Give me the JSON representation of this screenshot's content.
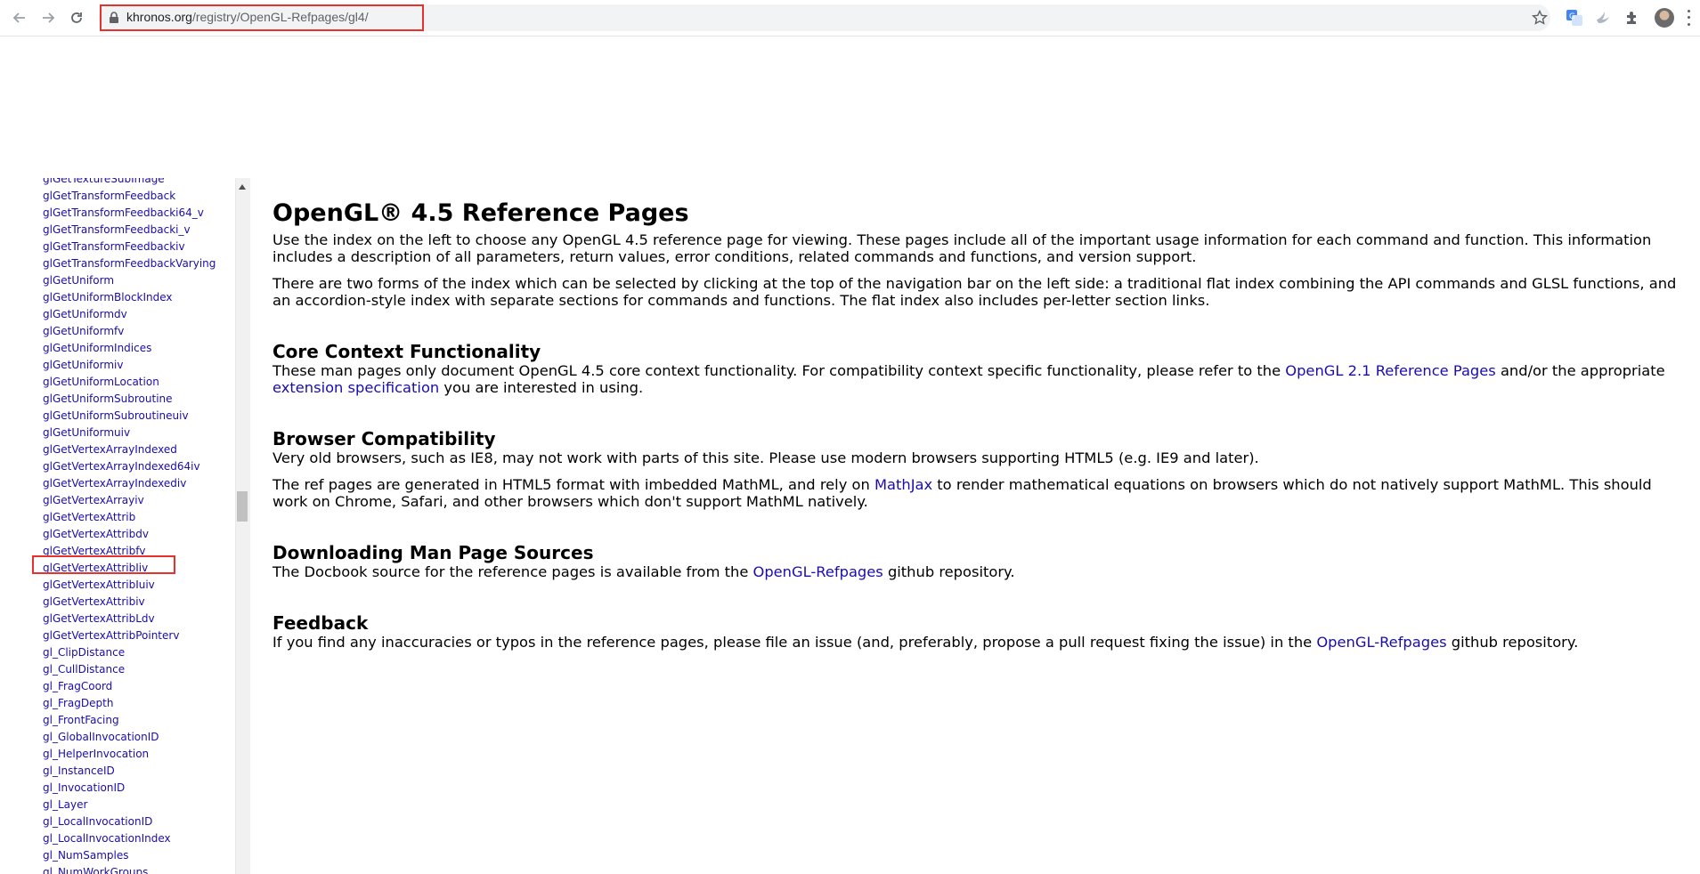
{
  "browser": {
    "url_domain": "khronos.org",
    "url_path": "/registry/OpenGL-Refpages/gl4/"
  },
  "sidebar": {
    "items": [
      "glGetTextureSubImage",
      "glGetTransformFeedback",
      "glGetTransformFeedbacki64_v",
      "glGetTransformFeedbacki_v",
      "glGetTransformFeedbackiv",
      "glGetTransformFeedbackVarying",
      "glGetUniform",
      "glGetUniformBlockIndex",
      "glGetUniformdv",
      "glGetUniformfv",
      "glGetUniformIndices",
      "glGetUniformiv",
      "glGetUniformLocation",
      "glGetUniformSubroutine",
      "glGetUniformSubroutineuiv",
      "glGetUniformuiv",
      "glGetVertexArrayIndexed",
      "glGetVertexArrayIndexed64iv",
      "glGetVertexArrayIndexediv",
      "glGetVertexArrayiv",
      "glGetVertexAttrib",
      "glGetVertexAttribdv",
      "glGetVertexAttribfv",
      "glGetVertexAttribIiv",
      "glGetVertexAttribIuiv",
      "glGetVertexAttribiv",
      "glGetVertexAttribLdv",
      "glGetVertexAttribPointerv",
      "gl_ClipDistance",
      "gl_CullDistance",
      "gl_FragCoord",
      "gl_FragDepth",
      "gl_FrontFacing",
      "gl_GlobalInvocationID",
      "gl_HelperInvocation",
      "gl_InstanceID",
      "gl_InvocationID",
      "gl_Layer",
      "gl_LocalInvocationID",
      "gl_LocalInvocationIndex",
      "gl_NumSamples",
      "gl_NumWorkGroups"
    ]
  },
  "main": {
    "title": "OpenGL® 4.5 Reference Pages",
    "intro_1": "Use the index on the left to choose any OpenGL 4.5 reference page for viewing. These pages include all of the important usage information for each command and function. This information includes a description of all parameters, return values, error conditions, related commands and functions, and version support.",
    "intro_2": "There are two forms of the index which can be selected by clicking at the top of the navigation bar on the left side: a traditional flat index combining the API commands and GLSL functions, and an accordion-style index with separate sections for commands and functions. The flat index also includes per-letter section links.",
    "core": {
      "heading": "Core Context Functionality",
      "text_a": "These man pages only document OpenGL 4.5 core context functionality. For compatibility context specific functionality, please refer to the ",
      "link_1": "OpenGL 2.1 Reference Pages",
      "text_b": " and/or the appropriate ",
      "link_2": "extension specification",
      "text_c": " you are interested in using."
    },
    "browser_compat": {
      "heading": "Browser Compatibility",
      "para_1": "Very old browsers, such as IE8, may not work with parts of this site. Please use modern browsers supporting HTML5 (e.g. IE9 and later).",
      "text_a": "The ref pages are generated in HTML5 format with imbedded MathML, and rely on ",
      "link": "MathJax",
      "text_b": " to render mathematical equations on browsers which do not natively support MathML. This should work on Chrome, Safari, and other browsers which don't support MathML natively."
    },
    "downloading": {
      "heading": "Downloading Man Page Sources",
      "text_a": "The Docbook source for the reference pages is available from the ",
      "link": "OpenGL-Refpages",
      "text_b": " github repository."
    },
    "feedback": {
      "heading": "Feedback",
      "text_a": "If you find any inaccuracies or typos in the reference pages, please file an issue (and, preferably, propose a pull request fixing the issue) in the ",
      "link": "OpenGL-Refpages",
      "text_b": " github repository."
    }
  }
}
